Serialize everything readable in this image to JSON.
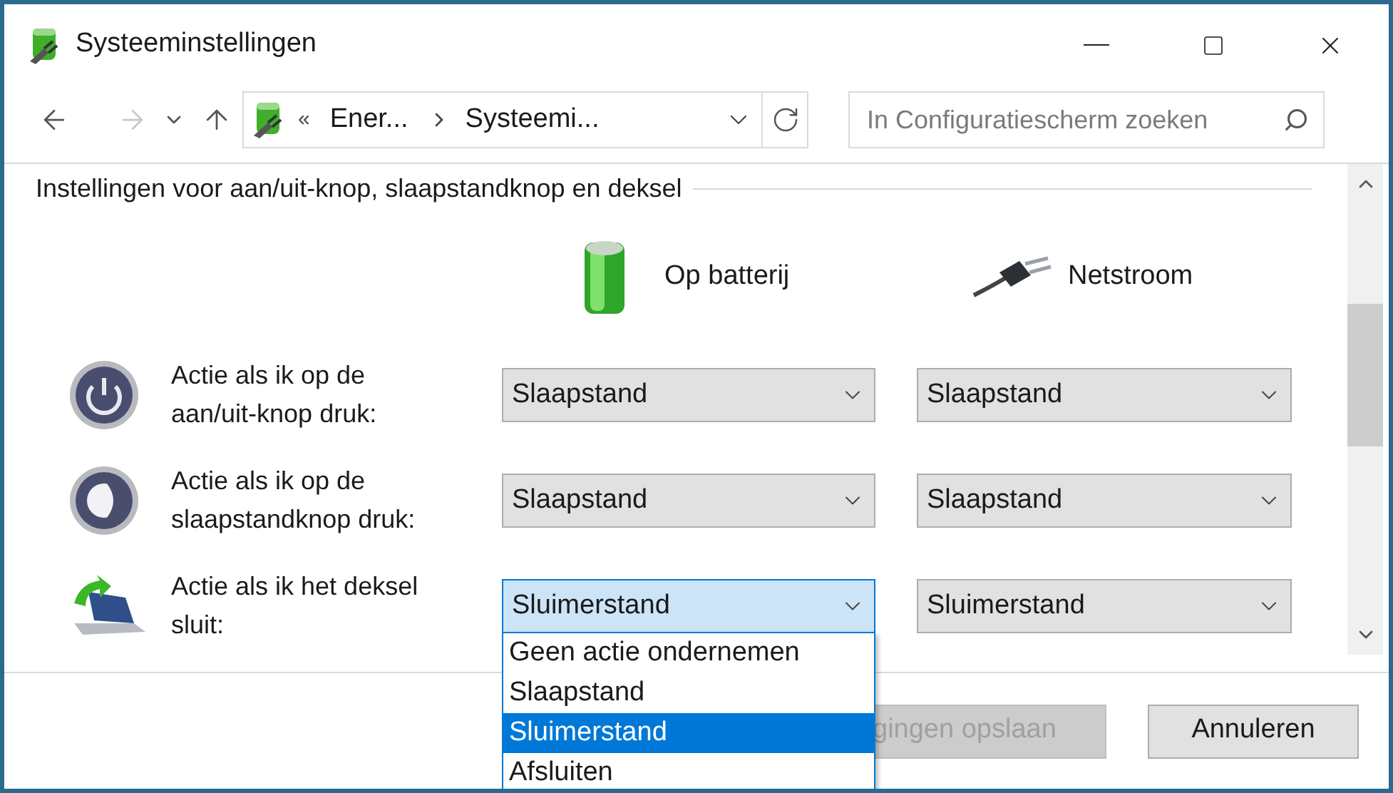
{
  "window": {
    "title": "Systeeminstellingen"
  },
  "navigation": {
    "back_disabled": false,
    "forward_disabled": true
  },
  "address_bar": {
    "overflow": "«",
    "breadcrumbs": [
      "Ener...",
      "Systeemi..."
    ]
  },
  "search": {
    "placeholder": "In Configuratiescherm zoeken"
  },
  "section_title": "Instellingen voor aan/uit-knop, slaapstandknop en deksel",
  "columns": [
    {
      "label": "Op batterij",
      "kind": "battery"
    },
    {
      "label": "Netstroom",
      "kind": "plug"
    }
  ],
  "settings": [
    {
      "label": "Actie als ik op de aan/uit-knop druk:",
      "kind": "power",
      "selects": [
        {
          "value": "Slaapstand",
          "focused": false,
          "open": false
        },
        {
          "value": "Slaapstand",
          "focused": false,
          "open": false
        }
      ]
    },
    {
      "label": "Actie als ik op de slaapstandknop druk:",
      "kind": "sleep",
      "selects": [
        {
          "value": "Slaapstand",
          "focused": false,
          "open": false
        },
        {
          "value": "Slaapstand",
          "focused": false,
          "open": false
        }
      ]
    },
    {
      "label": "Actie als ik het deksel sluit:",
      "kind": "lid",
      "selects": [
        {
          "value": "Sluimerstand",
          "focused": true,
          "open": true
        },
        {
          "value": "Sluimerstand",
          "focused": false,
          "open": false
        }
      ]
    }
  ],
  "dropdown_options": [
    {
      "label": "Geen actie ondernemen",
      "selected": false
    },
    {
      "label": "Slaapstand",
      "selected": false
    },
    {
      "label": "Sluimerstand",
      "selected": true
    },
    {
      "label": "Afsluiten",
      "selected": false
    }
  ],
  "buttons": [
    {
      "label": "gingen opslaan",
      "disabled": true
    },
    {
      "label": "Annuleren",
      "disabled": false
    }
  ]
}
